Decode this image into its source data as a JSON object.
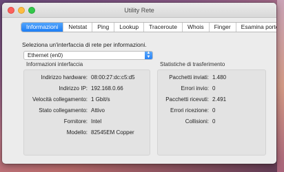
{
  "window": {
    "title": "Utility Rete"
  },
  "tabs": [
    "Informazioni",
    "Netstat",
    "Ping",
    "Lookup",
    "Traceroute",
    "Whois",
    "Finger",
    "Esamina porte"
  ],
  "prompt": "Seleziona un'interfaccia di rete per informazioni.",
  "interface_select": {
    "value": "Ethernet (en0)"
  },
  "info": {
    "title": "Informazioni interfaccia",
    "rows": [
      {
        "label": "Indirizzo hardware:",
        "value": "08:00:27:dc:c5:d5"
      },
      {
        "label": "Indirizzo IP:",
        "value": "192.168.0.66"
      },
      {
        "label": "Velocità collegamento:",
        "value": "1 Gbit/s"
      },
      {
        "label": "Stato collegamento:",
        "value": "Attivo"
      },
      {
        "label": "Fornitore:",
        "value": "Intel"
      },
      {
        "label": "Modello:",
        "value": "82545EM Copper"
      }
    ]
  },
  "stats": {
    "title": "Statistiche di trasferimento",
    "rows": [
      {
        "label": "Pacchetti inviati:",
        "value": "1.480"
      },
      {
        "label": "Errori invio:",
        "value": "0"
      },
      {
        "label": "Pacchetti ricevuti:",
        "value": "2.491"
      },
      {
        "label": "Errori ricezione:",
        "value": "0"
      },
      {
        "label": "Collisioni:",
        "value": "0"
      }
    ]
  }
}
